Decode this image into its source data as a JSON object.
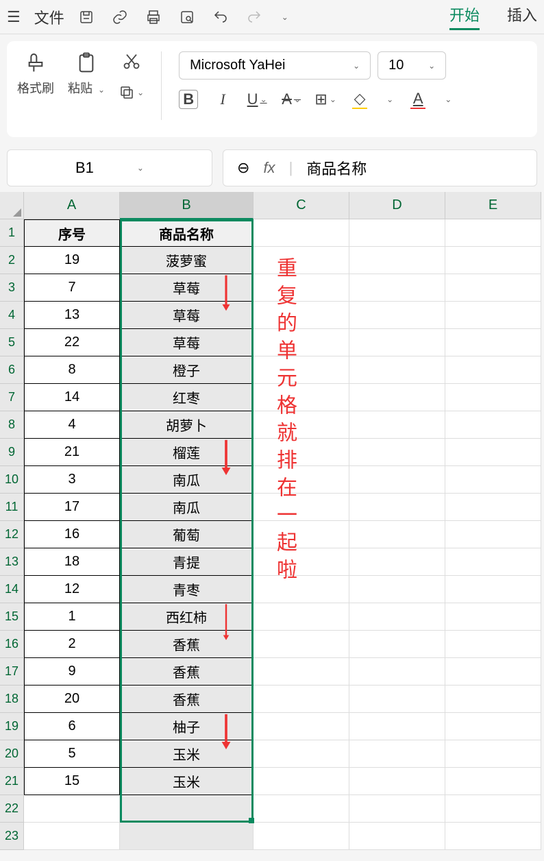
{
  "topbar": {
    "file_label": "文件",
    "tabs": {
      "start": "开始",
      "insert": "插入"
    }
  },
  "ribbon": {
    "format_painter": "格式刷",
    "paste": "粘贴",
    "font_name": "Microsoft YaHei",
    "font_size": "10"
  },
  "namebox": {
    "cell_ref": "B1"
  },
  "formula_bar": {
    "value": "商品名称"
  },
  "columns": [
    "A",
    "B",
    "C",
    "D",
    "E"
  ],
  "headers": {
    "col_a": "序号",
    "col_b": "商品名称"
  },
  "rows": [
    {
      "n": "19",
      "name": "菠萝蜜"
    },
    {
      "n": "7",
      "name": "草莓"
    },
    {
      "n": "13",
      "name": "草莓"
    },
    {
      "n": "22",
      "name": "草莓"
    },
    {
      "n": "8",
      "name": "橙子"
    },
    {
      "n": "14",
      "name": "红枣"
    },
    {
      "n": "4",
      "name": "胡萝卜"
    },
    {
      "n": "21",
      "name": "榴莲"
    },
    {
      "n": "3",
      "name": "南瓜"
    },
    {
      "n": "17",
      "name": "南瓜"
    },
    {
      "n": "16",
      "name": "葡萄"
    },
    {
      "n": "18",
      "name": "青提"
    },
    {
      "n": "12",
      "name": "青枣"
    },
    {
      "n": "1",
      "name": "西红柿"
    },
    {
      "n": "2",
      "name": "香蕉"
    },
    {
      "n": "9",
      "name": "香蕉"
    },
    {
      "n": "20",
      "name": "香蕉"
    },
    {
      "n": "6",
      "name": "柚子"
    },
    {
      "n": "5",
      "name": "玉米"
    },
    {
      "n": "15",
      "name": "玉米"
    }
  ],
  "annotation_text": "重复的单元格就排在一起啦"
}
